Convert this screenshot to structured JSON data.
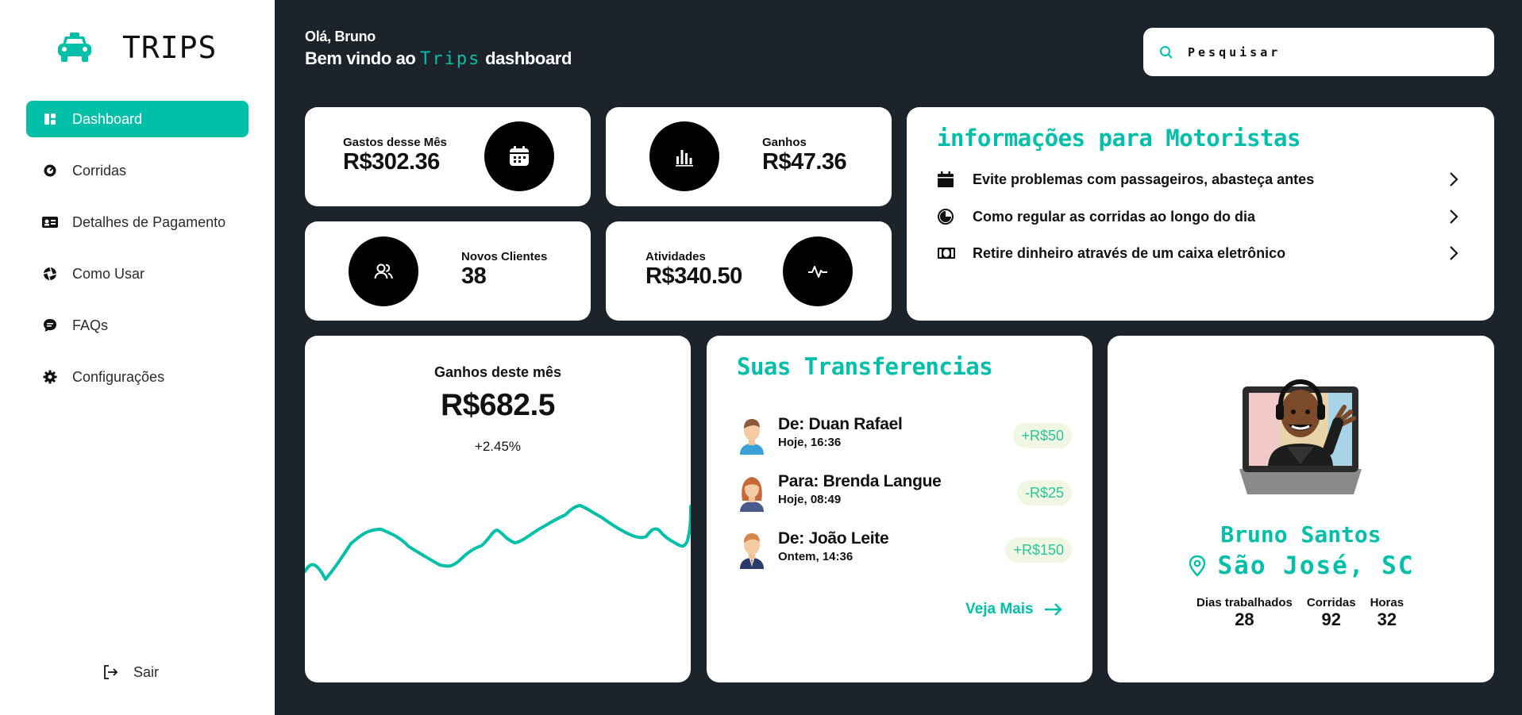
{
  "sidebar": {
    "brand": "TRIPS",
    "items": [
      {
        "label": "Dashboard",
        "icon": "dashboard-icon",
        "active": true
      },
      {
        "label": "Corridas",
        "icon": "speedometer-icon"
      },
      {
        "label": "Detalhes de Pagamento",
        "icon": "id-card-icon"
      },
      {
        "label": "Como Usar",
        "icon": "aperture-icon"
      },
      {
        "label": "FAQs",
        "icon": "chat-icon"
      },
      {
        "label": "Configurações",
        "icon": "gear-icon"
      }
    ],
    "logout": "Sair"
  },
  "header": {
    "hello": "Olá, Bruno",
    "welcome_prefix": "Bem vindo ao",
    "welcome_accent": "Trips",
    "welcome_suffix": "dashboard",
    "search_placeholder": "Pesquisar"
  },
  "stats": {
    "gastos": {
      "label": "Gastos desse Mês",
      "value": "R$302.36"
    },
    "ganhos": {
      "label": "Ganhos",
      "value": "R$47.36"
    },
    "clientes": {
      "label": "Novos Clientes",
      "value": "38"
    },
    "atividades": {
      "label": "Atividades",
      "value": "R$340.50"
    }
  },
  "info": {
    "title": "informações para Motoristas",
    "items": [
      {
        "text": "Evite problemas com passageiros, abasteça antes",
        "icon": "calendar-icon"
      },
      {
        "text": "Como regular as corridas ao longo do dia",
        "icon": "clock-icon"
      },
      {
        "text": "Retire dinheiro através de um caixa eletrônico",
        "icon": "money-icon"
      }
    ]
  },
  "earnings": {
    "title": "Ganhos deste mês",
    "amount": "R$682.5",
    "change": "+2.45%",
    "color": "#00bfa8"
  },
  "transfers": {
    "title": "Suas Transferencias",
    "items": [
      {
        "name": "De: Duan Rafael",
        "time": "Hoje, 16:36",
        "amount": "+R$50"
      },
      {
        "name": "Para: Brenda Langue",
        "time": "Hoje, 08:49",
        "amount": "-R$25"
      },
      {
        "name": "De: João Leite",
        "time": "Ontem, 14:36",
        "amount": "+R$150"
      }
    ],
    "more": "Veja Mais"
  },
  "profile": {
    "name": "Bruno Santos",
    "location": "São José, SC",
    "stats": [
      {
        "label": "Dias trabalhados",
        "value": "28"
      },
      {
        "label": "Corridas",
        "value": "92"
      },
      {
        "label": "Horas",
        "value": "32"
      }
    ]
  },
  "colors": {
    "accent": "#00bfa8",
    "background": "#1d232b",
    "card": "#ffffff"
  }
}
